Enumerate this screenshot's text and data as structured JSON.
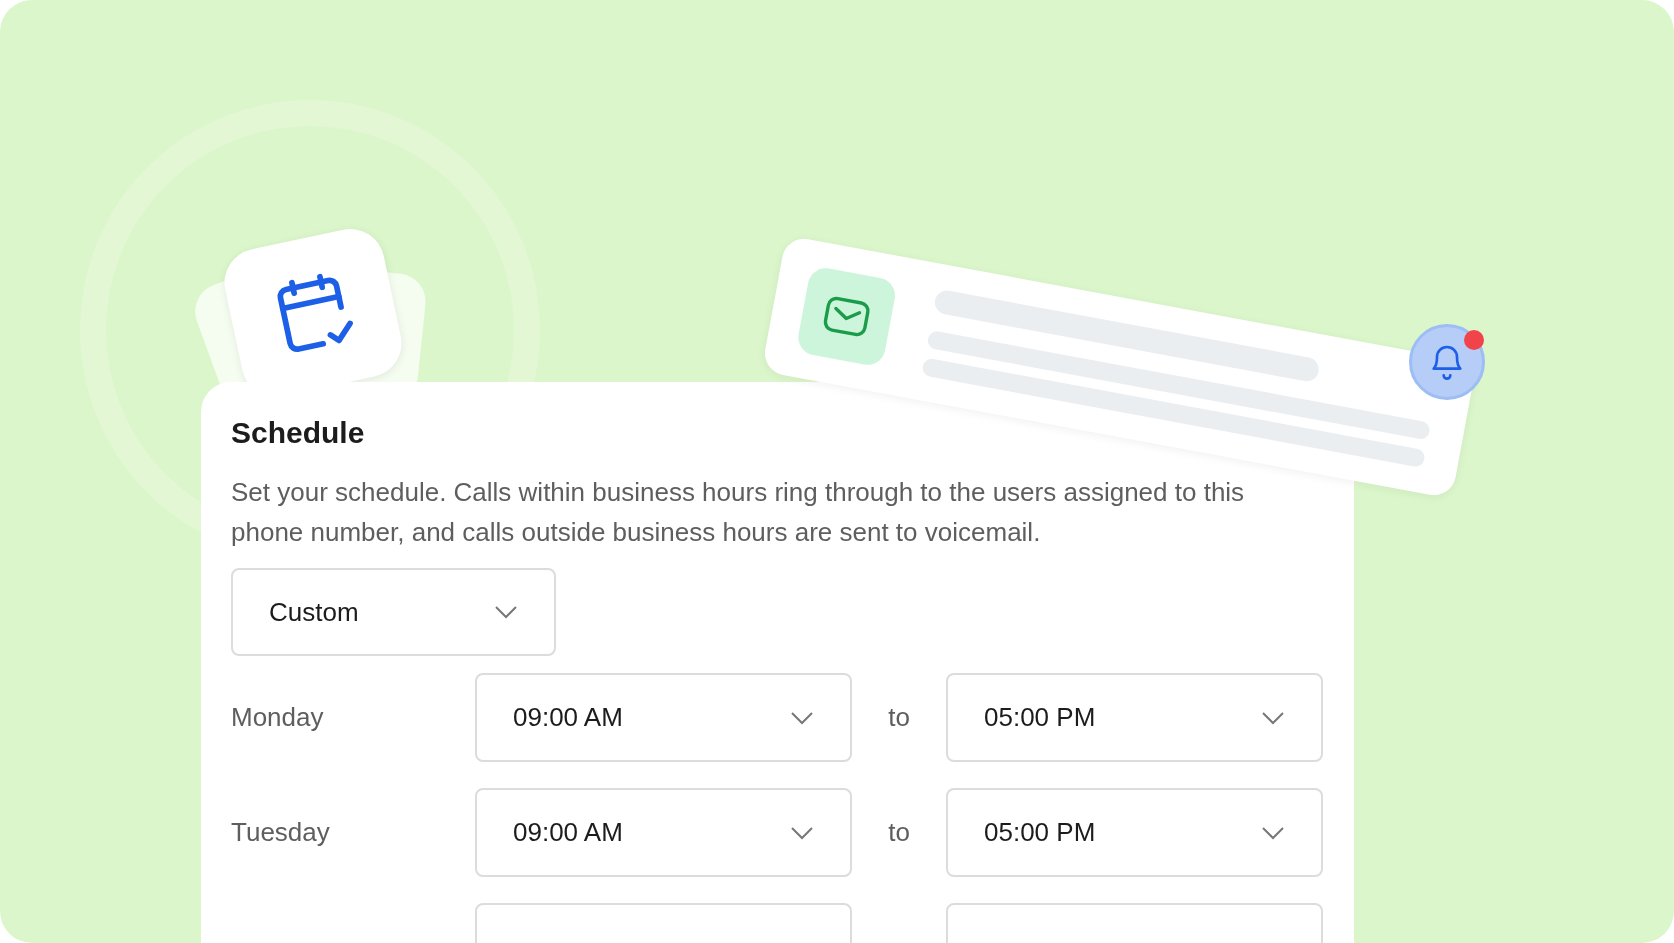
{
  "schedule": {
    "title": "Schedule",
    "description": "Set your schedule. Calls within business hours ring through to the users assigned to this phone number, and calls outside business hours are sent to voicemail.",
    "preset": "Custom",
    "days": [
      {
        "day": "Monday",
        "from": "09:00 AM",
        "separator": "to",
        "to": "05:00 PM"
      },
      {
        "day": "Tuesday",
        "from": "09:00 AM",
        "separator": "to",
        "to": "05:00 PM"
      }
    ]
  },
  "notification": {
    "unread": true
  }
}
